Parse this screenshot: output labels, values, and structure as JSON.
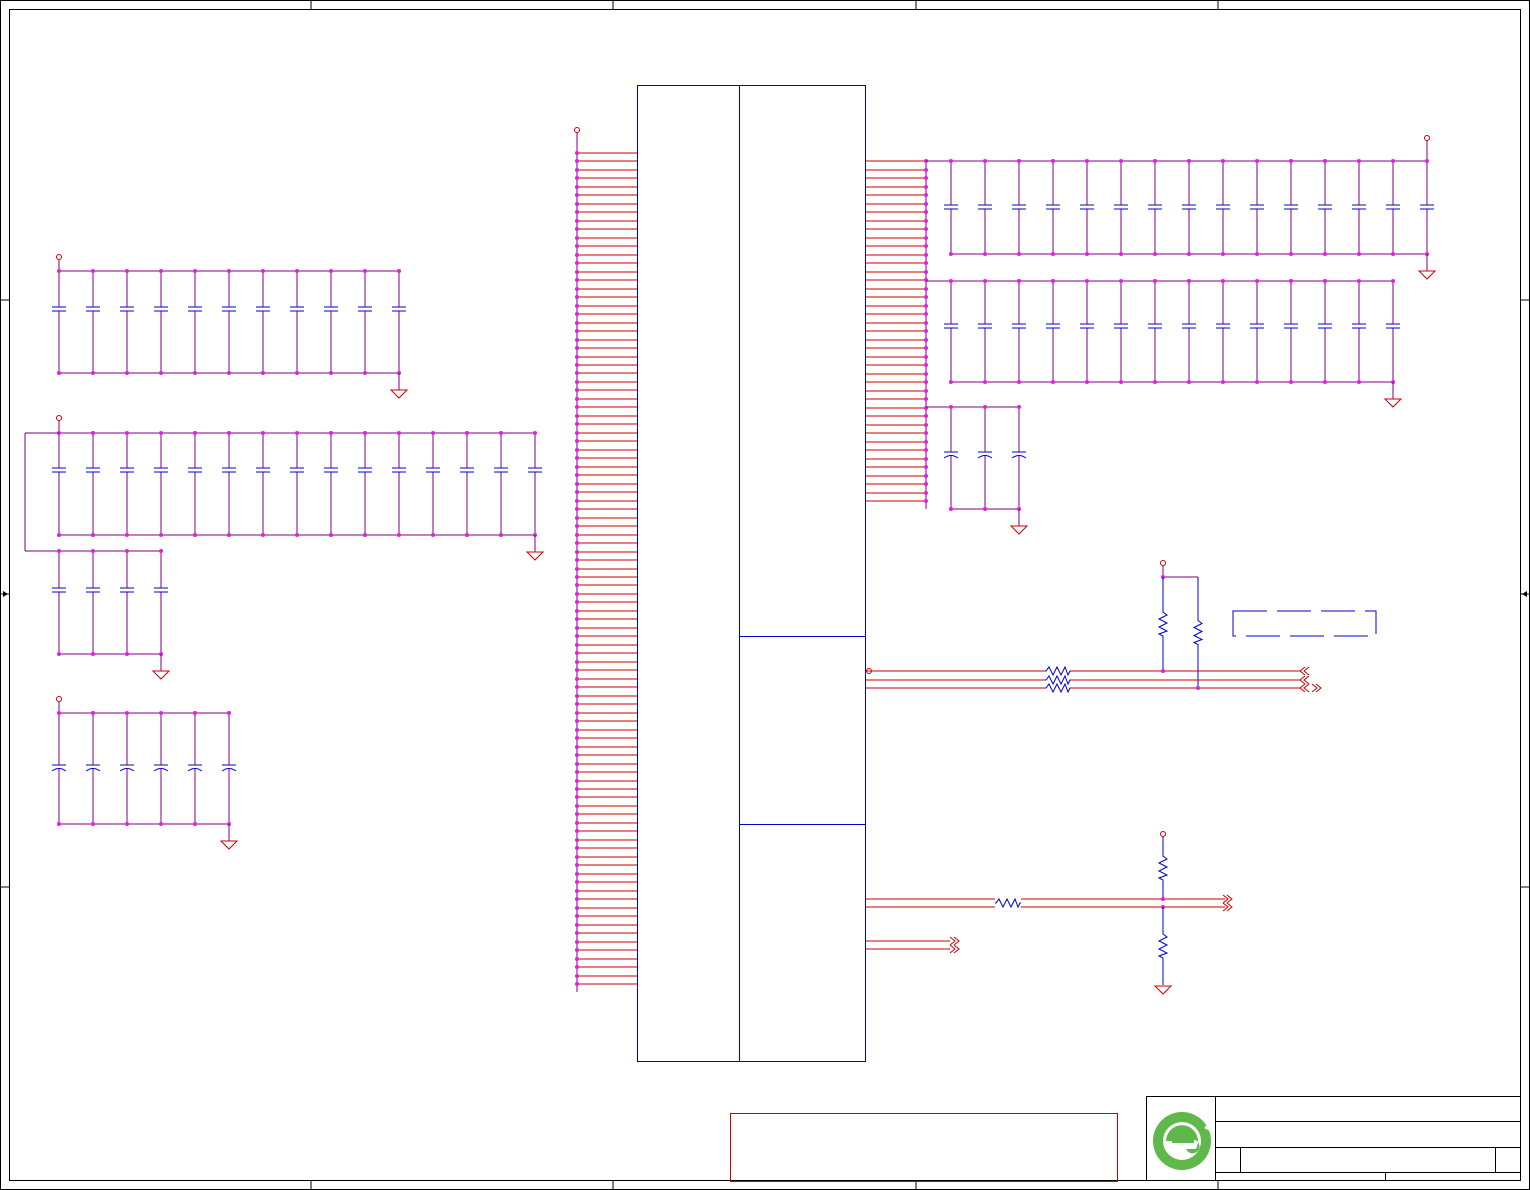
{
  "colors": {
    "border": "#000000",
    "wire": "#cc0000",
    "net": "#800080",
    "junction": "#e020e0",
    "component": "#0000cc",
    "logo_green": "#5fb84a",
    "background": "#ffffff"
  },
  "icons": {
    "logo": "company-logo-e",
    "ground": "ground-symbol",
    "power": "power-port-circle",
    "capacitor": "capacitor-symbol",
    "polarized_capacitor": "polarized-capacitor-symbol",
    "resistor": "resistor-zigzag-symbol",
    "port": "off-sheet-port-chevron"
  },
  "title_block": {
    "logo_visible": true
  }
}
